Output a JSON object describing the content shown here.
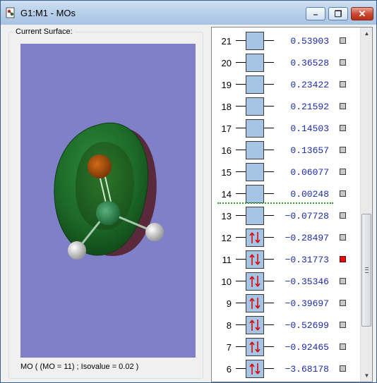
{
  "window": {
    "title": "G1:M1 - MOs",
    "minimize_glyph": "–",
    "restore_glyph": "❐",
    "close_glyph": "✕"
  },
  "surface_panel": {
    "label": "Current Surface:",
    "status": "MO ( (MO = 11) ; Isovalue = 0.02 )"
  },
  "orbitals": [
    {
      "num": "21",
      "energy": "0.53903",
      "occupied": false,
      "selected": false
    },
    {
      "num": "20",
      "energy": "0.36528",
      "occupied": false,
      "selected": false
    },
    {
      "num": "19",
      "energy": "0.23422",
      "occupied": false,
      "selected": false
    },
    {
      "num": "18",
      "energy": "0.21592",
      "occupied": false,
      "selected": false
    },
    {
      "num": "17",
      "energy": "0.14503",
      "occupied": false,
      "selected": false
    },
    {
      "num": "16",
      "energy": "0.13657",
      "occupied": false,
      "selected": false
    },
    {
      "num": "15",
      "energy": "0.06077",
      "occupied": false,
      "selected": false
    },
    {
      "num": "14",
      "energy": "0.00248",
      "occupied": false,
      "selected": false
    },
    {
      "num": "13",
      "energy": "−0.07728",
      "occupied": false,
      "selected": false
    },
    {
      "num": "12",
      "energy": "−0.28497",
      "occupied": true,
      "selected": false
    },
    {
      "num": "11",
      "energy": "−0.31773",
      "occupied": true,
      "selected": true
    },
    {
      "num": "10",
      "energy": "−0.35346",
      "occupied": true,
      "selected": false
    },
    {
      "num": "9",
      "energy": "−0.39697",
      "occupied": true,
      "selected": false
    },
    {
      "num": "8",
      "energy": "−0.52699",
      "occupied": true,
      "selected": false
    },
    {
      "num": "7",
      "energy": "−0.92465",
      "occupied": true,
      "selected": false
    },
    {
      "num": "6",
      "energy": "−3.68178",
      "occupied": true,
      "selected": false
    }
  ],
  "colors": {
    "viewport_bg": "#8080c8",
    "lobe_positive": "#1f6b2a",
    "lobe_negative": "#5a2a3c",
    "energy_text": "#1c2aa8",
    "homo_lumo_divider": "#2aa22a",
    "selected_check": "#e01010"
  }
}
